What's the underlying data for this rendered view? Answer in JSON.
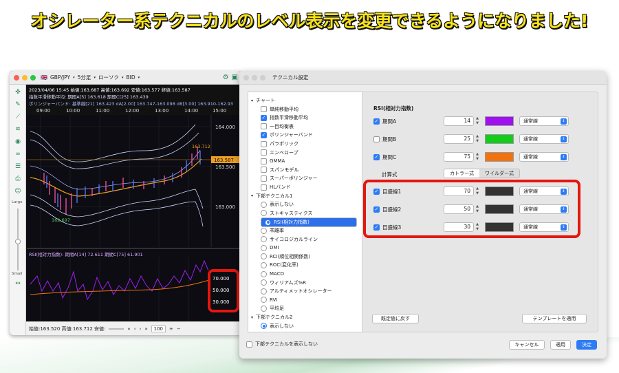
{
  "banner": {
    "text": "オシレーター系テクニカルのレベル表示を変更できるようになりました!"
  },
  "chart_window": {
    "toolbar": {
      "symbol": "GBP/JPY",
      "period": "5分足",
      "chart_type": "ローソク",
      "side": "BID"
    },
    "info_line1": "2023/04/06 15:45  始値:163.687 高値:163.692 安値:163.577 終値:163.587",
    "info_ema": "指数平滑移動平均: 期間A[5] 163.618 期間C[25] 163.439",
    "info_bb": "ボリンジャーバンド: 基準線[21] 163.423 σA[2.00] 163.747-163.098 σB[3.00] 163.910-162.93",
    "time_ticks": [
      "09:00",
      "10:00",
      "11:00",
      "12:00",
      "13:00",
      "14:00",
      "15:00"
    ],
    "price_ticks": [
      "164.000",
      "163.500",
      "163.000"
    ],
    "current_price": "163.587",
    "high_label": "163.712",
    "low_label": "162.697",
    "rsi_label": "RSI(相対力指数): 期間A[14] 72.611 期間C[75] 61.901",
    "rsi_levels": [
      "70.000",
      "50.000",
      "30.000"
    ],
    "zoom_large": "Large",
    "zoom_small": "Small",
    "bottom_info": "始値:163.520 高値:163.712 安値:",
    "zoom_value": "100"
  },
  "dialog": {
    "title": "テクニカル設定",
    "tree": {
      "chart_group": "チャート",
      "chart_items": [
        {
          "label": "単純移動平均",
          "checked": false
        },
        {
          "label": "指数平滑移動平均",
          "checked": true
        },
        {
          "label": "一目均衡表",
          "checked": false
        },
        {
          "label": "ボリンジャーバンド",
          "checked": true
        },
        {
          "label": "パラボリック",
          "checked": false
        },
        {
          "label": "エンベロープ",
          "checked": false
        },
        {
          "label": "GMMA",
          "checked": false
        },
        {
          "label": "スパンモデル",
          "checked": false
        },
        {
          "label": "スーパーボリンジャー",
          "checked": false
        },
        {
          "label": "HLバンド",
          "checked": false
        }
      ],
      "lower1_group": "下部テクニカル1",
      "lower1_items": [
        "表示しない",
        "ストキャスティクス",
        "RSI(相対力指数)",
        "乖離率",
        "サイコロジカルライン",
        "DMI",
        "RCI(順位相関係数)",
        "ROC(変化率)",
        "MACD",
        "ウィリアムズ%R",
        "アルティメットオシレーター",
        "RVI",
        "平均足"
      ],
      "lower1_selected": "RSI(相対力指数)",
      "lower2_group": "下部テクニカル2",
      "lower2_items": [
        "表示しない"
      ]
    },
    "panel": {
      "heading": "RSI(相対力指数)",
      "periods": [
        {
          "label": "期間A",
          "checked": true,
          "value": "14",
          "color": "#a010f0",
          "style": "通常線"
        },
        {
          "label": "期間B",
          "checked": false,
          "value": "25",
          "color": "#14cc1a",
          "style": "通常線"
        },
        {
          "label": "期間C",
          "checked": true,
          "value": "75",
          "color": "#f2720e",
          "style": "通常線"
        }
      ],
      "calc_label": "計算式",
      "calc_options": [
        "カトラー式",
        "ワイルダー式"
      ],
      "levels": [
        {
          "label": "目盛線1",
          "checked": true,
          "value": "70",
          "color": "#333333",
          "style": "通常線"
        },
        {
          "label": "目盛線2",
          "checked": true,
          "value": "50",
          "color": "#333333",
          "style": "通常線"
        },
        {
          "label": "目盛線3",
          "checked": true,
          "value": "30",
          "color": "#333333",
          "style": "通常線"
        }
      ],
      "reset_button": "既定値に戻す",
      "template_button": "テンプレートを適用"
    },
    "hide_lower_label": "下部テクニカルを表示しない",
    "cancel_button": "キャンセル",
    "apply_button": "適用",
    "ok_button": "決定"
  },
  "highlight_color": "#e3170f"
}
